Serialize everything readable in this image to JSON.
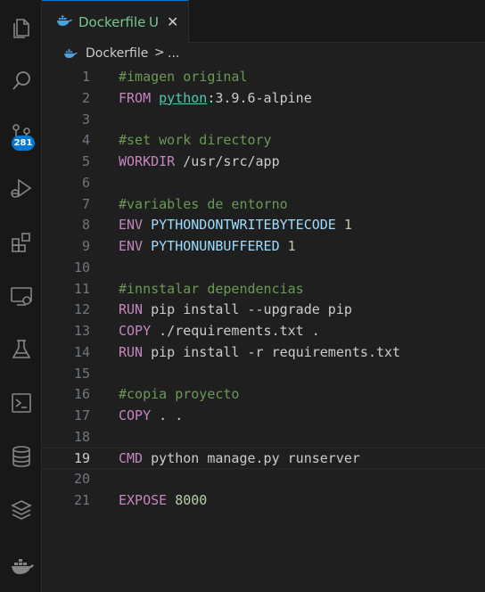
{
  "activity_bar": {
    "items": [
      "explorer-icon",
      "search-icon",
      "source-control-icon",
      "run-debug-icon",
      "extensions-icon",
      "remote-explorer-icon",
      "testing-icon",
      "terminal-icon",
      "database-icon",
      "layers-icon",
      "docker-icon"
    ],
    "scm_badge": "281",
    "colors": {
      "bg": "#181818",
      "icon": "#858585",
      "badge": "#0078d4"
    }
  },
  "tab": {
    "title": "Dockerfile",
    "status": "U",
    "close": "✕",
    "icon": "docker-icon",
    "color": "#73c991"
  },
  "breadcrumb": {
    "file": "Dockerfile",
    "separator": ">",
    "more": "..."
  },
  "editor": {
    "current_line": "19",
    "lines": [
      {
        "n": "1",
        "t": "#imagen original"
      },
      {
        "n": "2",
        "t": "FROM python:3.9.6-alpine"
      },
      {
        "n": "3",
        "t": ""
      },
      {
        "n": "4",
        "t": "#set work directory"
      },
      {
        "n": "5",
        "t": "WORKDIR /usr/src/app"
      },
      {
        "n": "6",
        "t": ""
      },
      {
        "n": "7",
        "t": "#variables de entorno"
      },
      {
        "n": "8",
        "t": "ENV PYTHONDONTWRITEBYTECODE 1"
      },
      {
        "n": "9",
        "t": "ENV PYTHONUNBUFFERED 1"
      },
      {
        "n": "10",
        "t": ""
      },
      {
        "n": "11",
        "t": "#innstalar dependencias"
      },
      {
        "n": "12",
        "t": "RUN pip install --upgrade pip"
      },
      {
        "n": "13",
        "t": "COPY ./requirements.txt ."
      },
      {
        "n": "14",
        "t": "RUN pip install -r requirements.txt"
      },
      {
        "n": "15",
        "t": ""
      },
      {
        "n": "16",
        "t": "#copia proyecto"
      },
      {
        "n": "17",
        "t": "COPY . ."
      },
      {
        "n": "18",
        "t": ""
      },
      {
        "n": "19",
        "t": "CMD python manage.py runserver"
      },
      {
        "n": "20",
        "t": ""
      },
      {
        "n": "21",
        "t": "EXPOSE 8000"
      }
    ],
    "tokens": {
      "l1": [
        "#imagen original"
      ],
      "l2": [
        "FROM",
        " ",
        "python",
        ":3.9.6-alpine"
      ],
      "l4": [
        "#set work directory"
      ],
      "l5": [
        "WORKDIR",
        " /usr/src/app"
      ],
      "l7": [
        "#variables de entorno"
      ],
      "l8": [
        "ENV",
        " ",
        "PYTHONDONTWRITEBYTECODE",
        " ",
        "1"
      ],
      "l9": [
        "ENV",
        " ",
        "PYTHONUNBUFFERED",
        " ",
        "1"
      ],
      "l11": [
        "#innstalar dependencias"
      ],
      "l12": [
        "RUN",
        " pip install --upgrade pip"
      ],
      "l13": [
        "COPY",
        " ./requirements.txt ."
      ],
      "l14": [
        "RUN",
        " pip install -r requirements.txt"
      ],
      "l16": [
        "#copia proyecto"
      ],
      "l17": [
        "COPY",
        " . ."
      ],
      "l19": [
        "CMD",
        " python manage.py runserver"
      ],
      "l21": [
        "EXPOSE",
        " ",
        "8000"
      ]
    },
    "colors": {
      "keyword": "#c586c0",
      "comment": "#6a9955",
      "variable": "#9cdcfe",
      "number": "#b5cea8",
      "text": "#cccccc",
      "linenumber": "#6e7681"
    }
  }
}
